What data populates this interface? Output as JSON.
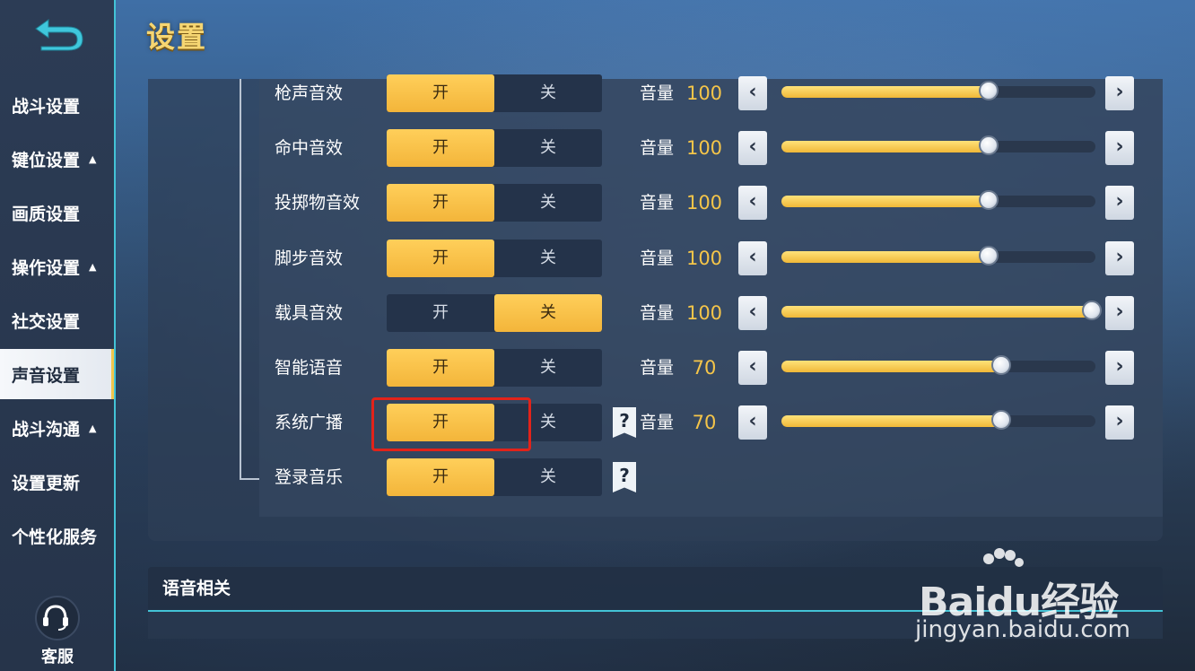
{
  "header": {
    "title": "设置"
  },
  "sidebar": {
    "items": [
      {
        "label": "战斗设置",
        "caret": ""
      },
      {
        "label": "键位设置",
        "caret": "▲"
      },
      {
        "label": "画质设置",
        "caret": ""
      },
      {
        "label": "操作设置",
        "caret": "▲"
      },
      {
        "label": "社交设置",
        "caret": ""
      },
      {
        "label": "声音设置",
        "caret": "",
        "active": true
      },
      {
        "label": "战斗沟通",
        "caret": "▲"
      },
      {
        "label": "设置更新",
        "caret": ""
      },
      {
        "label": "个性化服务",
        "caret": ""
      }
    ],
    "service_label": "客服"
  },
  "toggle_labels": {
    "on": "开",
    "off": "关"
  },
  "volume_label": "音量",
  "rows": [
    {
      "label": "枪声音效",
      "state": "on",
      "volume": "100",
      "level": 0.66,
      "help": false
    },
    {
      "label": "命中音效",
      "state": "on",
      "volume": "100",
      "level": 0.66,
      "help": false
    },
    {
      "label": "投掷物音效",
      "state": "on",
      "volume": "100",
      "level": 0.66,
      "help": false
    },
    {
      "label": "脚步音效",
      "state": "on",
      "volume": "100",
      "level": 0.66,
      "help": false
    },
    {
      "label": "载具音效",
      "state": "off",
      "volume": "100",
      "level": 1.0,
      "help": false
    },
    {
      "label": "智能语音",
      "state": "on",
      "volume": "70",
      "level": 0.7,
      "help": false
    },
    {
      "label": "系统广播",
      "state": "on",
      "volume": "70",
      "level": 0.7,
      "help": true
    },
    {
      "label": "登录音乐",
      "state": "on",
      "volume": null,
      "level": null,
      "help": true
    }
  ],
  "voice_section": {
    "title": "语音相关"
  },
  "watermark": {
    "brand": "Baidu经验",
    "url": "jingyan.baidu.com"
  },
  "colors": {
    "accent": "#f5c549",
    "cyan": "#43c3d6",
    "highlight": "#e2231a"
  }
}
